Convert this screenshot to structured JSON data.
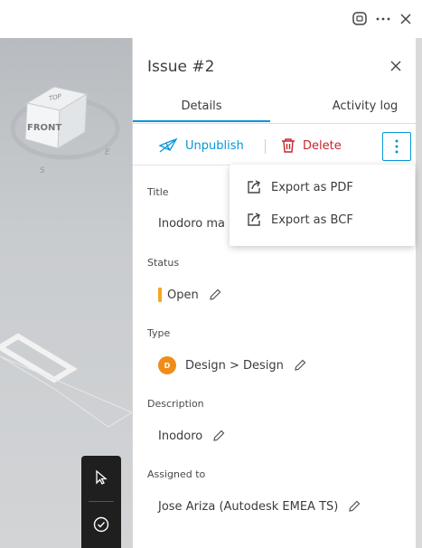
{
  "topbar": {
    "icons": [
      "chat-bubble-icon",
      "more-horizontal-icon",
      "close-icon"
    ]
  },
  "viewcube": {
    "top_label": "TOP",
    "front_label": "FRONT",
    "compass_e": "E",
    "compass_s": "S"
  },
  "panel": {
    "title": "Issue #2",
    "tabs": [
      {
        "label": "Details",
        "active": true
      },
      {
        "label": "Activity log",
        "active": false
      }
    ],
    "actions": {
      "unpublish_label": "Unpublish",
      "delete_label": "Delete"
    },
    "fields": {
      "title": {
        "label": "Title",
        "value": "Inodoro ma"
      },
      "status": {
        "label": "Status",
        "value": "Open",
        "color": "#f5a623"
      },
      "type": {
        "label": "Type",
        "value": "Design > Design",
        "avatar": "D",
        "avatar_color": "#f08c19"
      },
      "description": {
        "label": "Description",
        "value": "Inodoro"
      },
      "assigned_to": {
        "label": "Assigned to",
        "value": "Jose Ariza (Autodesk EMEA TS)"
      }
    }
  },
  "menu": {
    "items": [
      {
        "label": "Export as PDF",
        "icon": "export-icon"
      },
      {
        "label": "Export as BCF",
        "icon": "export-icon"
      }
    ]
  },
  "colors": {
    "accent": "#0696d7",
    "danger": "#c4262e"
  }
}
